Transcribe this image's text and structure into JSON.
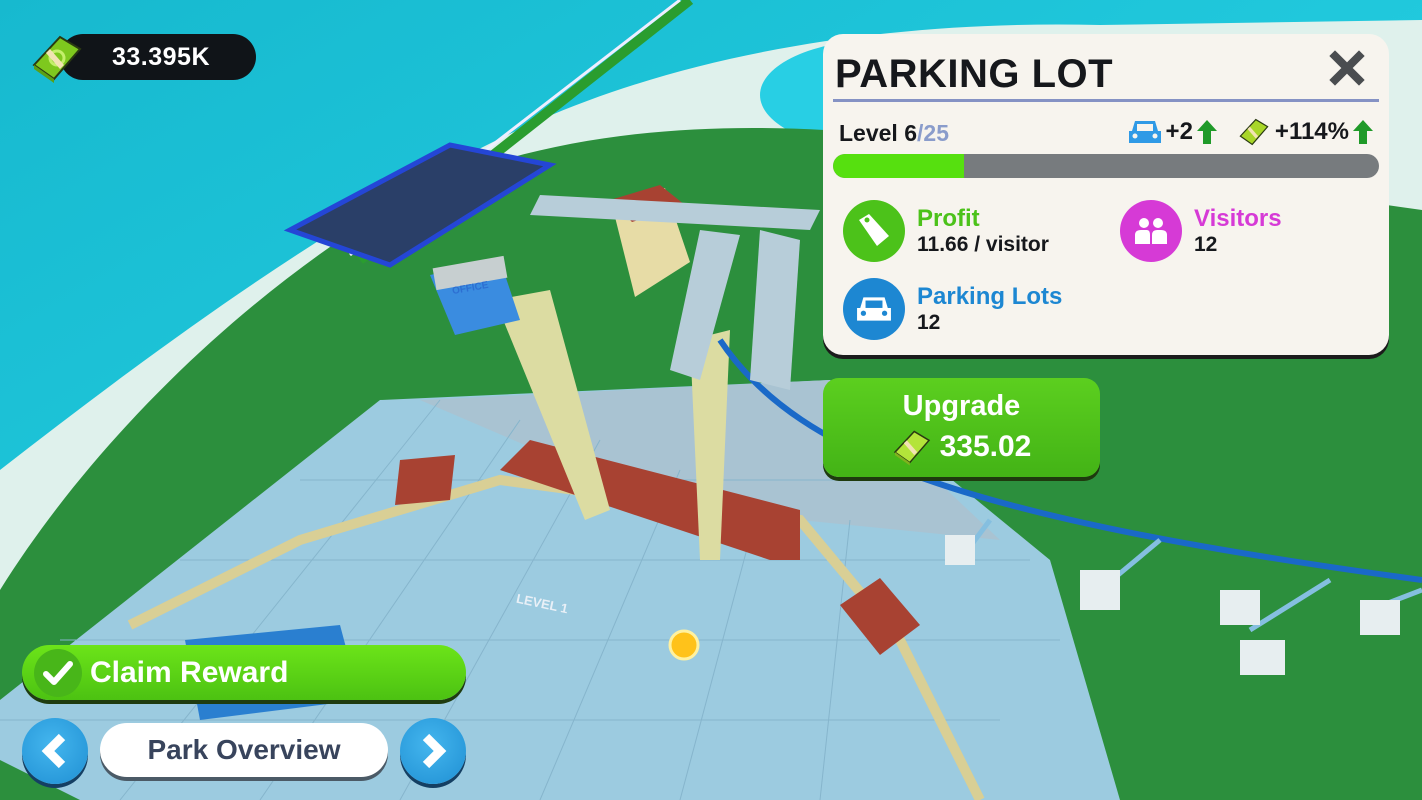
{
  "hud": {
    "currency_icon": "cash-stack-icon",
    "currency_value": "33.395K"
  },
  "panel": {
    "title": "PARKING LOT",
    "close_icon": "close-icon",
    "level_prefix": "Level ",
    "level_current": "6",
    "level_max": "/25",
    "level_progress_fraction": 0.24,
    "boosts": [
      {
        "icon": "car-icon",
        "value": "+2",
        "trend_icon": "arrow-up-icon"
      },
      {
        "icon": "cash-stack-icon",
        "value": "+114%",
        "trend_icon": "arrow-up-icon"
      }
    ],
    "stats": [
      {
        "icon": "price-tag-icon",
        "label": "Profit",
        "value": "11.66 / visitor",
        "color": "#4cc21a"
      },
      {
        "icon": "visitors-icon",
        "label": "Visitors",
        "value": "12",
        "color": "#d63ad6"
      },
      {
        "icon": "car-icon",
        "label": "Parking Lots",
        "value": "12",
        "color": "#1d87d2"
      }
    ]
  },
  "upgrade": {
    "label": "Upgrade",
    "cost": "335.02",
    "cost_icon": "cash-stack-icon"
  },
  "bottom": {
    "claim_label": "Claim Reward",
    "claim_icon": "checkmark-icon",
    "prev_icon": "chevron-left-icon",
    "next_icon": "chevron-right-icon",
    "view_label": "Park Overview"
  },
  "scene": {
    "office_sign": "OFFICE",
    "ground_label": "LEVEL 1"
  },
  "colors": {
    "accent_green": "#56e00f",
    "button_blue": "#2a9ee0",
    "panel_bg": "#f7f4ee",
    "divider": "#8592c4"
  }
}
